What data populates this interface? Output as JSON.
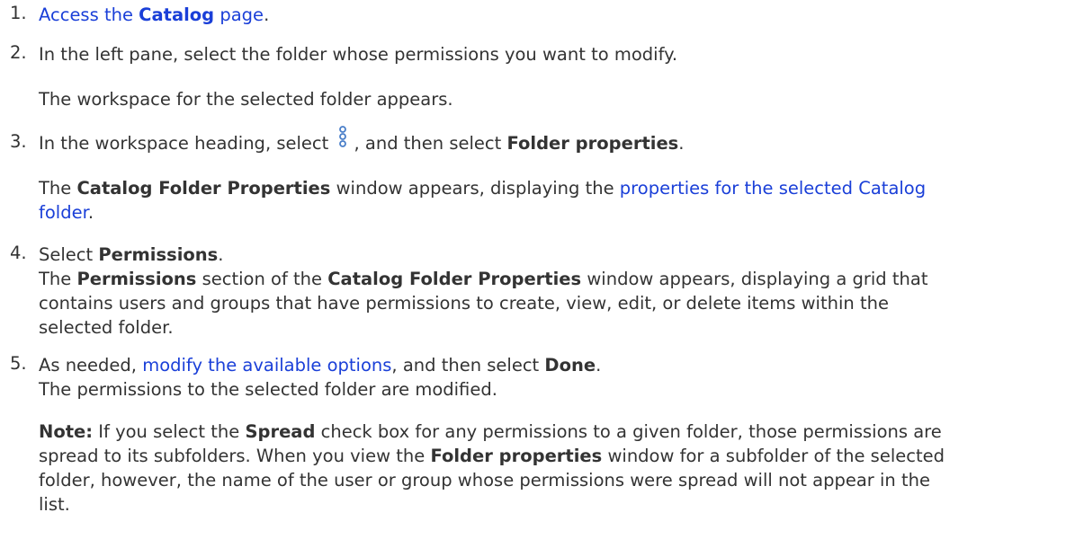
{
  "steps": [
    {
      "number": "1.",
      "pre": "Access the ",
      "bold": "Catalog",
      "post": " page",
      "end": "."
    },
    {
      "number": "2.",
      "text": "In the left pane, select the folder whose permissions you want to modify.",
      "result": "The workspace for the selected folder appears."
    },
    {
      "number": "3.",
      "pre": "In the workspace heading, select",
      "mid": ", and then select ",
      "bold": "Folder properties",
      "end": ".",
      "icon": "kebab-menu-icon",
      "result_pre": "The ",
      "result_bold": "Catalog Folder Properties",
      "result_mid": " window appears, displaying the ",
      "result_link_line1": "properties for the selected Catalog",
      "result_link_line2": "folder",
      "result_end": "."
    },
    {
      "number": "4.",
      "pre": "Select ",
      "bold": "Permissions",
      "end": ".",
      "r_pre": "The ",
      "r_bold1": "Permissions",
      "r_mid": " section of the ",
      "r_bold2": "Catalog Folder Properties",
      "r_line1_end": " window appears, displaying a grid that",
      "r_line2": "contains users and groups that have permissions to create, view, edit, or delete items within the",
      "r_line3": "selected folder."
    },
    {
      "number": "5.",
      "pre": "As needed, ",
      "link": "modify the available options",
      "mid": ", and then select ",
      "bold": "Done",
      "end": ".",
      "result": "The permissions to the selected folder are modified.",
      "note_label": "Note:",
      "n1_pre": " If you select the ",
      "n1_bold": "Spread",
      "n1_post": " check box for any permissions to a given folder, those permissions are",
      "n2_pre": "spread to its subfolders. When you view the ",
      "n2_bold": "Folder properties",
      "n2_post": " window for a subfolder of the selected",
      "n3": "folder, however, the name of the user or group whose permissions were spread will not appear in the",
      "n4": "list."
    }
  ],
  "colors": {
    "text": "#333333",
    "link": "#1a3fd8",
    "icon": "#4a7fc9"
  }
}
